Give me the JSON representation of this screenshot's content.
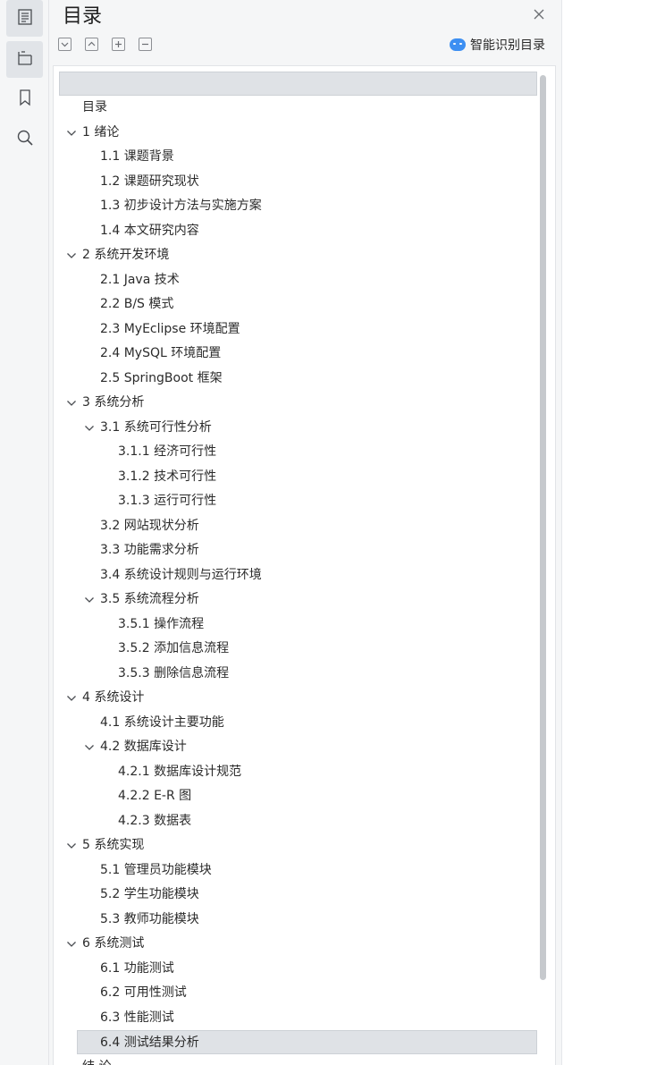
{
  "panel": {
    "title": "目录",
    "smart_toc_label": "智能识别目录"
  },
  "toc": [
    {
      "label": "目录",
      "level": 0,
      "expand": false
    },
    {
      "label": "1  绪论",
      "level": 0,
      "expand": true
    },
    {
      "label": "1.1  课题背景",
      "level": 1,
      "expand": false
    },
    {
      "label": "1.2  课题研究现状",
      "level": 1,
      "expand": false
    },
    {
      "label": "1.3  初步设计方法与实施方案",
      "level": 1,
      "expand": false
    },
    {
      "label": "1.4  本文研究内容",
      "level": 1,
      "expand": false
    },
    {
      "label": "2  系统开发环境",
      "level": 0,
      "expand": true
    },
    {
      "label": "2.1 Java 技术",
      "level": 1,
      "expand": false
    },
    {
      "label": "2.2 B/S 模式",
      "level": 1,
      "expand": false
    },
    {
      "label": "2.3 MyEclipse 环境配置",
      "level": 1,
      "expand": false
    },
    {
      "label": "2.4 MySQL 环境配置",
      "level": 1,
      "expand": false
    },
    {
      "label": "2.5 SpringBoot 框架",
      "level": 1,
      "expand": false
    },
    {
      "label": "3  系统分析",
      "level": 0,
      "expand": true
    },
    {
      "label": "3.1  系统可行性分析",
      "level": 1,
      "expand": true
    },
    {
      "label": "3.1.1  经济可行性",
      "level": 2,
      "expand": false
    },
    {
      "label": "3.1.2  技术可行性",
      "level": 2,
      "expand": false
    },
    {
      "label": "3.1.3  运行可行性",
      "level": 2,
      "expand": false
    },
    {
      "label": "3.2  网站现状分析",
      "level": 1,
      "expand": false
    },
    {
      "label": "3.3  功能需求分析",
      "level": 1,
      "expand": false
    },
    {
      "label": "3.4  系统设计规则与运行环境",
      "level": 1,
      "expand": false
    },
    {
      "label": "3.5 系统流程分析",
      "level": 1,
      "expand": true
    },
    {
      "label": "3.5.1 操作流程",
      "level": 2,
      "expand": false
    },
    {
      "label": "3.5.2 添加信息流程",
      "level": 2,
      "expand": false
    },
    {
      "label": "3.5.3 删除信息流程",
      "level": 2,
      "expand": false
    },
    {
      "label": "4  系统设计",
      "level": 0,
      "expand": true
    },
    {
      "label": "4.1  系统设计主要功能",
      "level": 1,
      "expand": false
    },
    {
      "label": "4.2  数据库设计",
      "level": 1,
      "expand": true
    },
    {
      "label": "4.2.1  数据库设计规范",
      "level": 2,
      "expand": false
    },
    {
      "label": "4.2.2 E-R 图",
      "level": 2,
      "expand": false
    },
    {
      "label": "4.2.3  数据表",
      "level": 2,
      "expand": false
    },
    {
      "label": "5  系统实现",
      "level": 0,
      "expand": true
    },
    {
      "label": "5.1 管理员功能模块",
      "level": 1,
      "expand": false
    },
    {
      "label": "5.2 学生功能模块",
      "level": 1,
      "expand": false
    },
    {
      "label": "5.3 教师功能模块",
      "level": 1,
      "expand": false
    },
    {
      "label": "6  系统测试",
      "level": 0,
      "expand": true
    },
    {
      "label": "6.1  功能测试",
      "level": 1,
      "expand": false
    },
    {
      "label": "6.2  可用性测试",
      "level": 1,
      "expand": false
    },
    {
      "label": "6.3  性能测试",
      "level": 1,
      "expand": false
    },
    {
      "label": "6.4 测试结果分析",
      "level": 1,
      "expand": false,
      "selected": true
    },
    {
      "label": "结 论",
      "level": 0,
      "expand": false
    }
  ]
}
